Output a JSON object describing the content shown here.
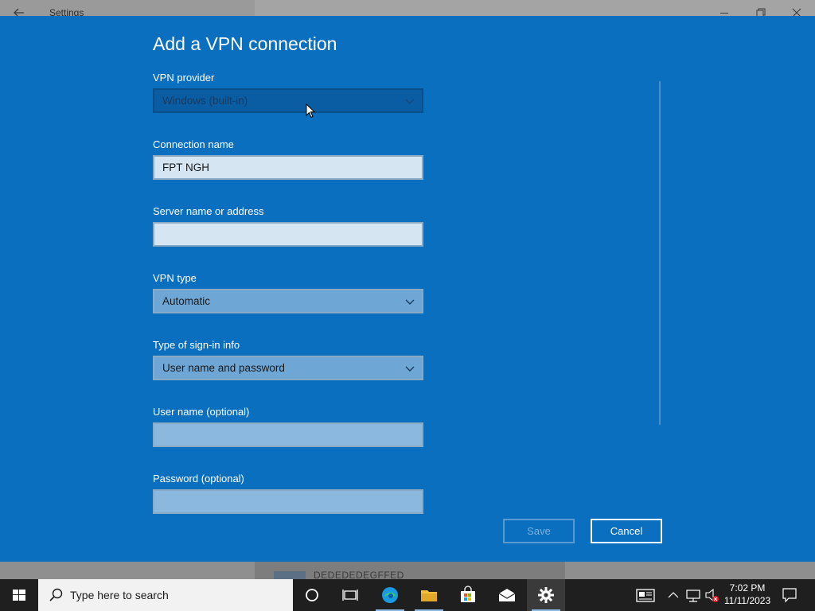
{
  "window": {
    "title": "Settings"
  },
  "background_page": {
    "partial_text": "DEDEDEDEGFFED"
  },
  "dialog": {
    "title": "Add a VPN connection",
    "fields": {
      "vpn_provider": {
        "label": "VPN provider",
        "value": "Windows (built-in)"
      },
      "connection_name": {
        "label": "Connection name",
        "value": "FPT NGH"
      },
      "server": {
        "label": "Server name or address",
        "value": ""
      },
      "vpn_type": {
        "label": "VPN type",
        "value": "Automatic"
      },
      "signin_type": {
        "label": "Type of sign-in info",
        "value": "User name and password"
      },
      "username": {
        "label": "User name (optional)",
        "value": ""
      },
      "password": {
        "label": "Password (optional)",
        "value": ""
      }
    },
    "buttons": {
      "save": "Save",
      "cancel": "Cancel"
    }
  },
  "taskbar": {
    "search_placeholder": "Type here to search",
    "time": "7:02 PM",
    "date": "11/11/2023"
  },
  "colors": {
    "dialog_bg": "#0b6fbf",
    "taskbar_bg": "#1f1f1f"
  }
}
